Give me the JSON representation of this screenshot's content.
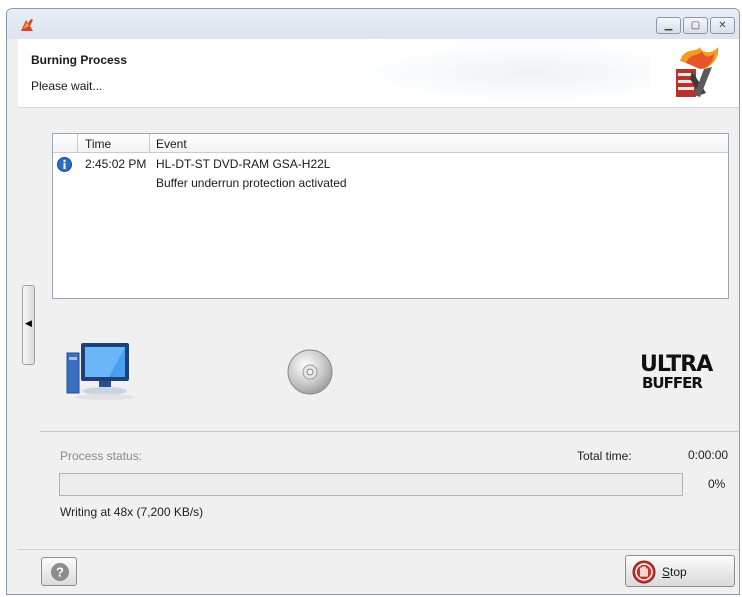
{
  "header": {
    "title": "Burning Process",
    "subtitle": "Please wait..."
  },
  "log": {
    "columns": {
      "time": "Time",
      "event": "Event"
    },
    "rows": [
      {
        "icon": "info-icon",
        "time": "2:45:02 PM",
        "lines": [
          "HL-DT-ST DVD-RAM GSA-H22L",
          "Buffer underrun protection activated"
        ]
      }
    ]
  },
  "visuals": {
    "computer": "computer-icon",
    "disc": "cd-disc-icon",
    "logo_line1": "ULTRA",
    "logo_line2": "BUFFER"
  },
  "status": {
    "process_status_label": "Process status:",
    "total_time_label": "Total time:",
    "total_time_value": "0:00:00",
    "progress_percent": "0%",
    "progress_fraction": 0,
    "writing_text": "Writing at 48x (7,200 KB/s)"
  },
  "buttons": {
    "stop": "Stop",
    "stop_mnemonic": "S",
    "help_icon": "help-icon"
  },
  "colors": {
    "accent_red": "#c2312b",
    "info_blue": "#2f6bc6"
  }
}
